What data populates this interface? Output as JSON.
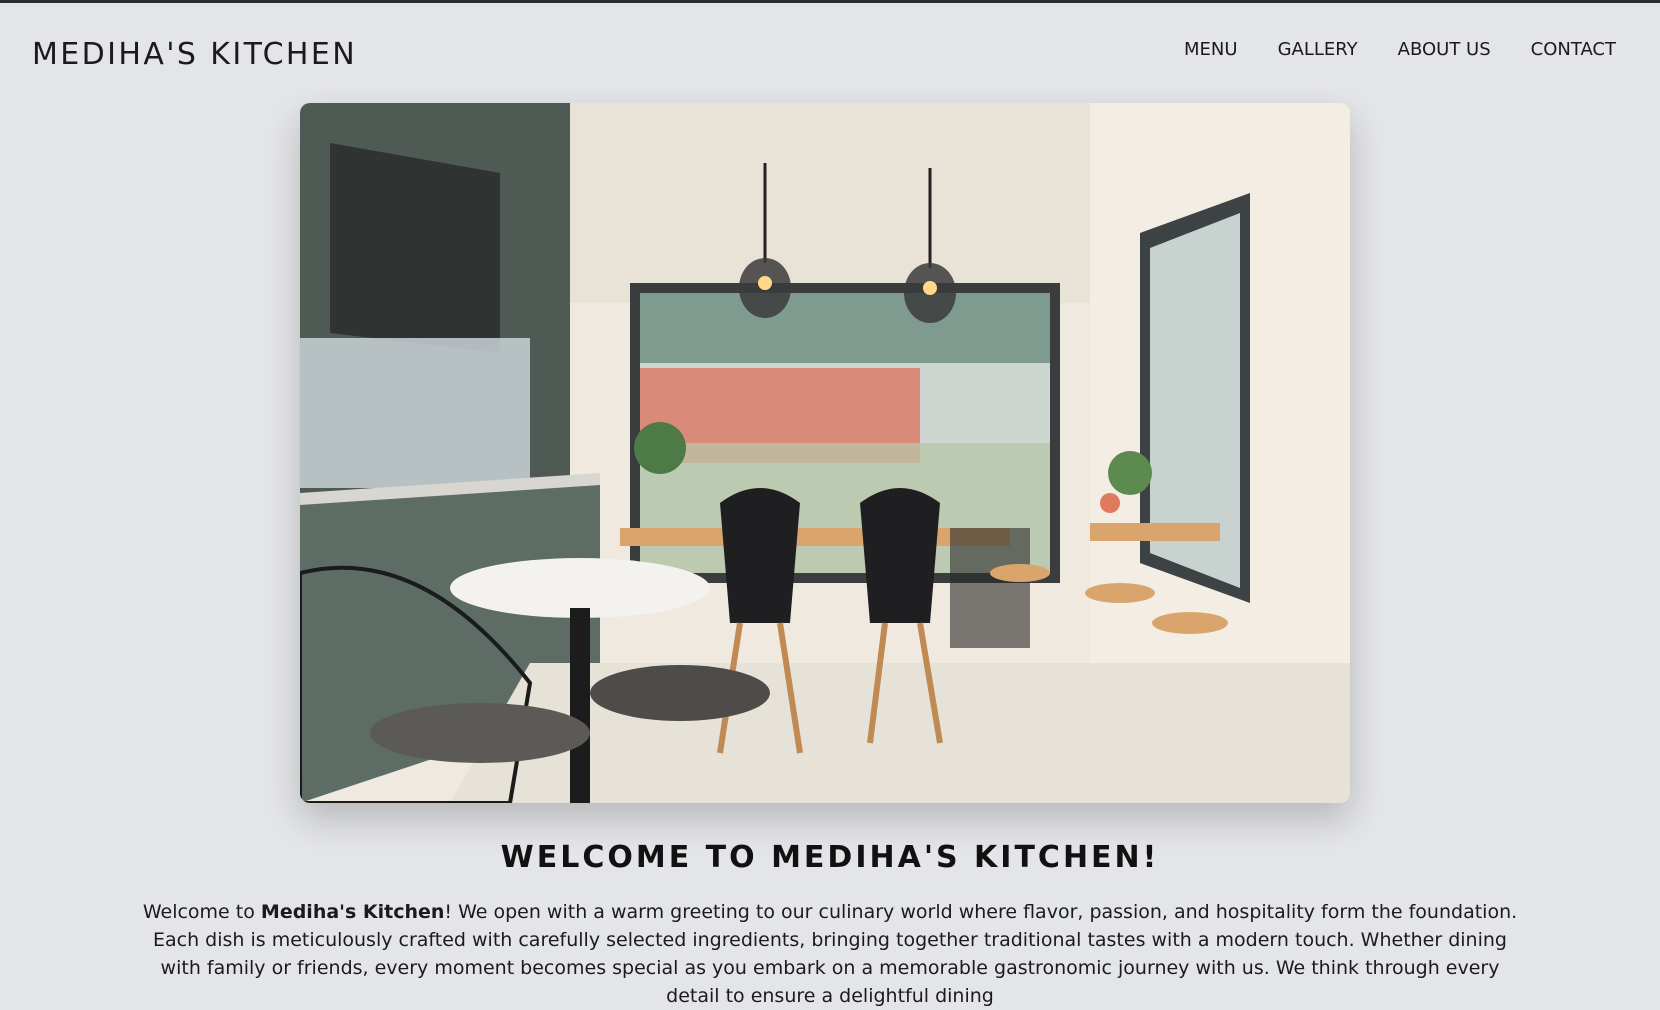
{
  "header": {
    "brand": "MEDIHA'S KITCHEN",
    "nav": [
      {
        "label": "MENU"
      },
      {
        "label": "GALLERY"
      },
      {
        "label": "ABOUT US"
      },
      {
        "label": "CONTACT"
      }
    ]
  },
  "hero": {
    "image_subject": "restaurant-interior-photo"
  },
  "welcome": {
    "title": "WELCOME TO MEDIHA'S KITCHEN!",
    "intro_prefix": "Welcome to ",
    "intro_bold": "Mediha's Kitchen",
    "intro_rest": "! We open with a warm greeting to our culinary world where flavor, passion, and hospitality form the foundation. Each dish is meticulously crafted with carefully selected ingredients, bringing together traditional tastes with a modern touch. Whether dining with family or friends, every moment becomes special as you embark on a memorable gastronomic journey with us. We think through every detail to ensure a delightful dining"
  },
  "colors": {
    "background": "#e4e5e8",
    "text": "#1b1b1d",
    "topline": "#2b2d31"
  }
}
